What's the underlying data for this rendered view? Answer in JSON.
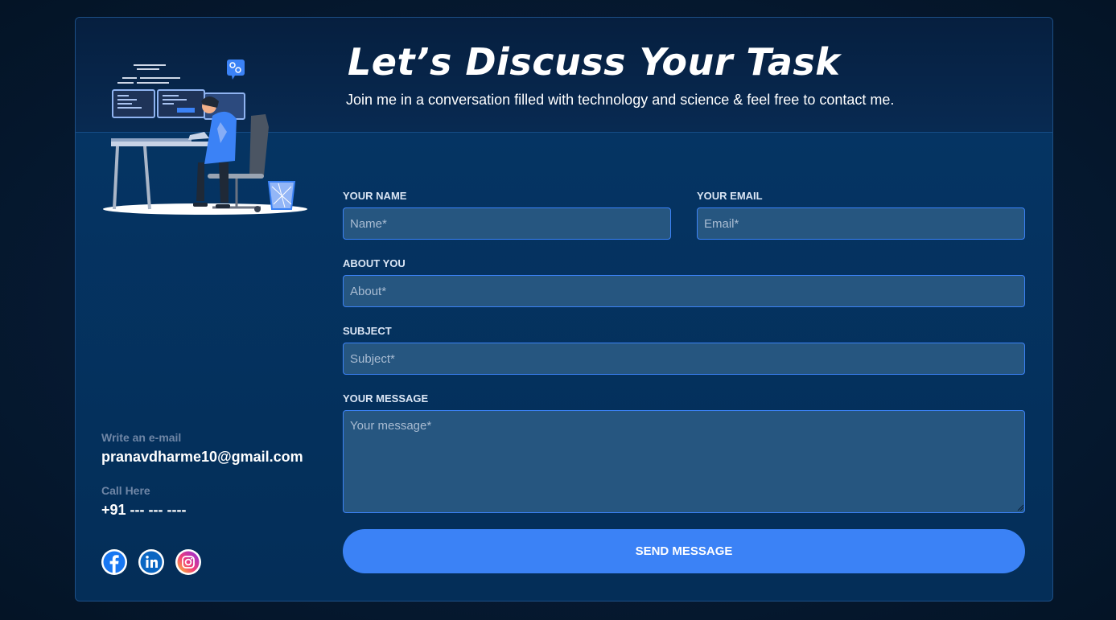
{
  "header": {
    "title": "Let’s Discuss Your Task",
    "subtitle": "Join me in a conversation filled with technology and science & feel free to contact me."
  },
  "contact": {
    "email_label": "Write an e-mail",
    "email_value": "pranavdharme10@gmail.com",
    "phone_label": "Call Here",
    "phone_value": "+91 --- --- ----"
  },
  "social": {
    "icons": [
      "facebook-icon",
      "linkedin-icon",
      "instagram-icon"
    ]
  },
  "form": {
    "name_label": "YOUR NAME",
    "name_placeholder": "Name*",
    "email_label": "YOUR EMAIL",
    "email_placeholder": "Email*",
    "about_label": "ABOUT YOU",
    "about_placeholder": "About*",
    "subject_label": "SUBJECT",
    "subject_placeholder": "Subject*",
    "message_label": "YOUR MESSAGE",
    "message_placeholder": "Your message*",
    "send_label": "SEND MESSAGE"
  },
  "colors": {
    "accent": "#3b82f6",
    "card_background": "#04325f",
    "input_background": "#265680",
    "muted_label": "#6f86a6"
  }
}
